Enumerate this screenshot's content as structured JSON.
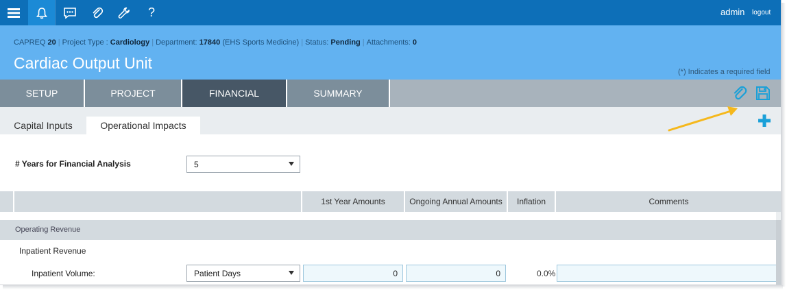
{
  "topbar": {
    "user": "admin",
    "logout": "logout",
    "help_glyph": "?"
  },
  "header": {
    "capreq_label": "CAPREQ",
    "capreq_value": "20",
    "project_type_label": "Project Type :",
    "project_type_value": "Cardiology",
    "department_label": "Department:",
    "department_code": "17840",
    "department_name": "(EHS Sports Medicine)",
    "status_label": "Status:",
    "status_value": "Pending",
    "attachments_label": "Attachments:",
    "attachments_value": "0",
    "title": "Cardiac Output Unit",
    "required_note": "(*) Indicates a required field"
  },
  "tabs": [
    {
      "label": "SETUP"
    },
    {
      "label": "PROJECT"
    },
    {
      "label": "FINANCIAL"
    },
    {
      "label": "SUMMARY"
    }
  ],
  "subtabs": [
    {
      "label": "Capital Inputs"
    },
    {
      "label": "Operational Impacts"
    }
  ],
  "form": {
    "years_label": "# Years for Financial Analysis",
    "years_value": "5"
  },
  "grid": {
    "columns": [
      "1st Year Amounts",
      "Ongoing Annual Amounts",
      "Inflation",
      "Comments"
    ],
    "section": "Operating Revenue",
    "subsection": "Inpatient Revenue",
    "row": {
      "label": "Inpatient Volume:",
      "unit_value": "Patient Days",
      "first_year": "0",
      "ongoing": "0",
      "inflation": "0.0%",
      "comment": ""
    }
  },
  "colors": {
    "topbar": "#0d6fb8",
    "header": "#62b2f1",
    "tab_active": "#475766",
    "tab_inactive": "#7c8e9b",
    "accent_icon": "#1aa0d8",
    "arrow": "#f5b81c"
  }
}
